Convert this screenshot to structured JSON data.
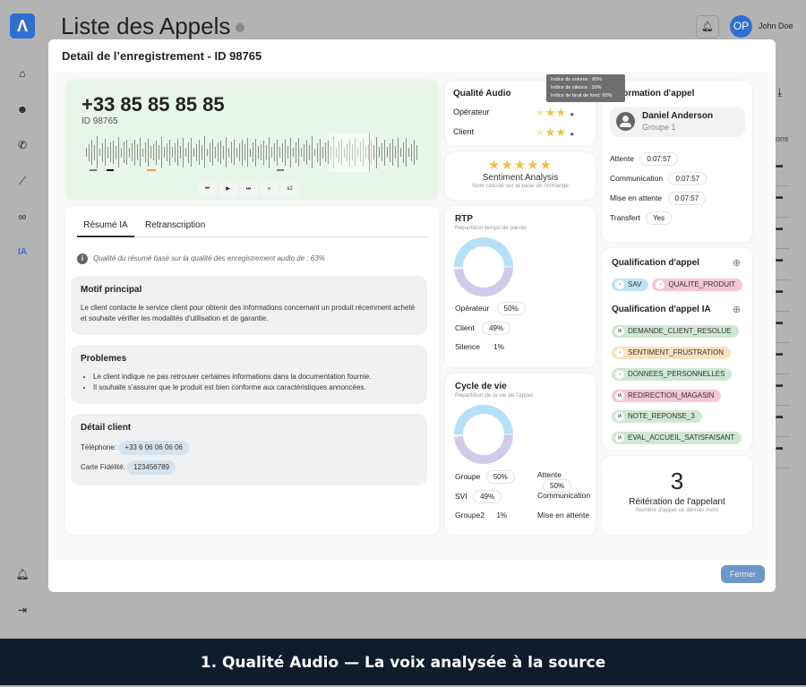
{
  "app": {
    "page_title": "Liste des Appels",
    "logo": "Λ",
    "user_initials": "OP",
    "user_name": "John Doe",
    "sidebar_ia": "IA",
    "table_header_partial": "ons"
  },
  "modal": {
    "title": "Detail de l’enregistrement - ID 98765",
    "close_label": "Fermer"
  },
  "recording": {
    "phone": "+33 85 85 85 85",
    "id": "ID 98765",
    "speed": "x2"
  },
  "summary": {
    "tabs": [
      "Résumé IA",
      "Retranscription"
    ],
    "active_tab": 0,
    "quality_note": "Qualité du résumé basé sur la qualité des enregistrement audio de : 63%",
    "motif_title": "Motif principal",
    "motif_text": "Le client contacte le service client pour obtenir des informations concernant un produit récemment acheté et souhaite vérifier les modalités d’utilisation et de garantie.",
    "problems_title": "Problemes",
    "problems": [
      "Le client indique ne pas retrouver certaines informations dans la documentation fournie.",
      "Il souhaite s’assurer que le produit est bien conforme aux caractéristiques annoncées."
    ],
    "client_title": "Détail client",
    "phone_label": "Téléphone:",
    "phone_value": "+33 6 06 06 06 06",
    "card_label": "Carte Fidélité:",
    "card_value": "123456789"
  },
  "audio_quality": {
    "title": "Qualité Audio",
    "operator_label": "Opérateur",
    "operator_stars": 2.5,
    "client_label": "Client",
    "client_stars": 2.5,
    "tooltip": [
      "Indice de volume : 80%",
      "Indice de silence : 30%",
      "Indice de bruit de fond: 60%"
    ]
  },
  "sentiment": {
    "title": "Sentiment Analysis",
    "subtitle": "Note calculé sur la base de l'échange",
    "stars": 5
  },
  "rtp": {
    "title": "RTP",
    "subtitle": "Répartition temps de parole",
    "rows": [
      {
        "label": "Opérateur",
        "value": "50%"
      },
      {
        "label": "Client",
        "value": "49%"
      },
      {
        "label": "Silence",
        "value": "1%"
      }
    ],
    "colors": [
      "#b4e1f8",
      "#d2caeb",
      "#eeeeee"
    ]
  },
  "cycle": {
    "title": "Cycle de vie",
    "subtitle": "Répartition de la vie de l'appel",
    "left": [
      {
        "label": "Groupe",
        "value": "50%"
      },
      {
        "label": "SVI",
        "value": "49%"
      },
      {
        "label": "Groupe2",
        "value": "1%"
      }
    ],
    "right": [
      {
        "label": "Attente",
        "value": "50%"
      },
      {
        "label": "Communication"
      },
      {
        "label": "Mise en attente"
      }
    ]
  },
  "call_info": {
    "title": "Information d'appel",
    "agent_name": "Daniel Anderson",
    "agent_group": "Groupe 1",
    "rows": [
      {
        "label": "Attente",
        "value": "0:07:57"
      },
      {
        "label": "Communication",
        "value": "0:07:57"
      },
      {
        "label": "Mise en attente",
        "value": "0:07:57"
      },
      {
        "label": "Transfert",
        "value": "Yes"
      }
    ]
  },
  "qualification": {
    "title": "Qualification d'appel",
    "tags": [
      {
        "label": "SAV",
        "color": "#bfe3f7"
      },
      {
        "label": "QUALITE_PRODUIT",
        "color": "#f6c6d6"
      }
    ],
    "ia_title": "Qualification d'appel IA",
    "ia_tags": [
      {
        "label": "DEMANDE_CLIENT_RESOLUE",
        "icon": "IA",
        "color": "#cfe8d3"
      },
      {
        "label": "SENTIMENT_FRUSTRATION",
        "icon": "user",
        "color": "#fbe2bf"
      },
      {
        "label": "DONNEES_PERSONNELLES",
        "icon": "user",
        "color": "#cfe8d3"
      },
      {
        "label": "REDIRECTION_MAGASIN",
        "icon": "IA",
        "color": "#f6c6d6"
      },
      {
        "label": "NOTE_REPONSE_3",
        "icon": "IA",
        "color": "#cfe8d3"
      },
      {
        "label": "EVAL_ACCUEIL_SATISFAISANT",
        "icon": "IA",
        "color": "#cfe8d3"
      }
    ]
  },
  "reiteration": {
    "count": "3",
    "title": "Réitération de l'appelant",
    "subtitle": "Nombre d'appel ce dernier mois"
  },
  "caption": "1. Qualité Audio — La voix analysée à la source"
}
